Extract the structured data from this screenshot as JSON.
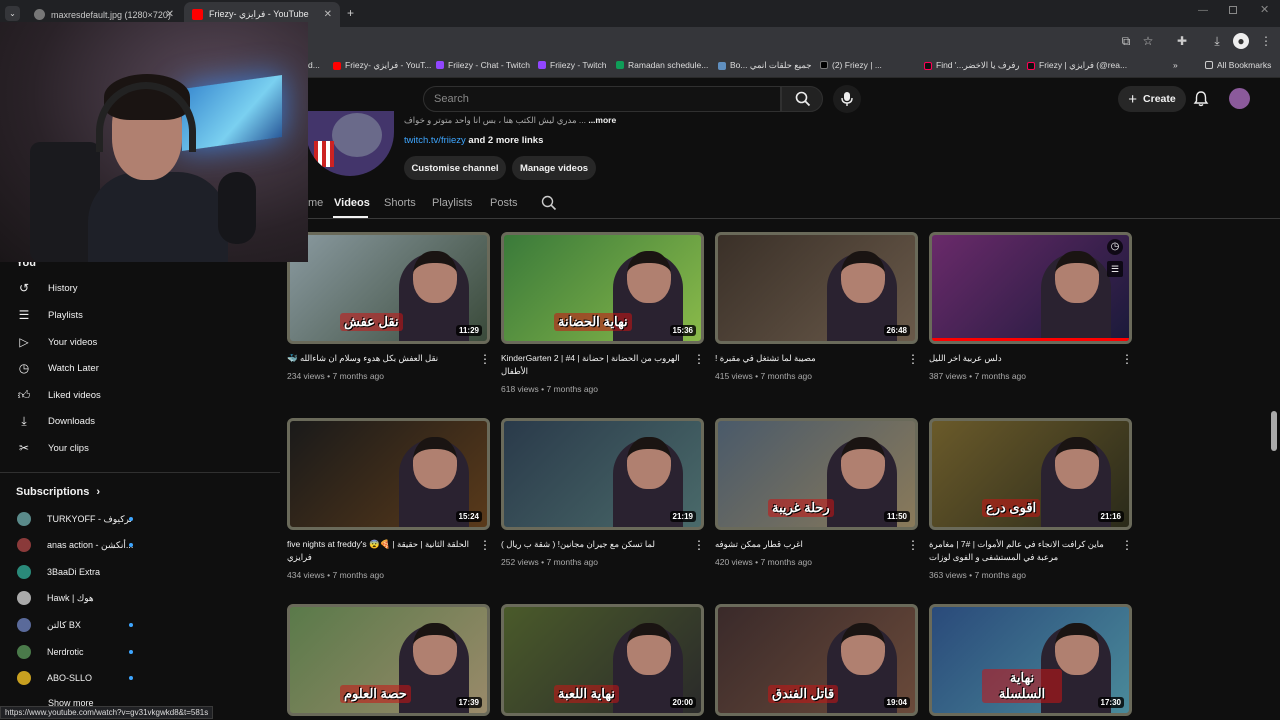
{
  "browser": {
    "tabs": [
      {
        "title": "maxresdefault.jpg (1280×720)",
        "active": false
      },
      {
        "title": "Friezy- فرايزي - YouTube",
        "active": true
      }
    ],
    "bookmarks": [
      "d...",
      "Friezy- فرايزي - YouT...",
      "Friiezy - Chat - Twitch",
      "Friiezy - Twitch",
      "Ramadan schedule...",
      "Bo... جميع حلقات انمي",
      "(2) Friezy | ...",
      "Find '...رفرف يا الاخضر",
      "Friezy | فرايزي (@rea...",
      "All Bookmarks"
    ],
    "status_url": "https://www.youtube.com/watch?v=gv31vkgwkd8&t=581s"
  },
  "header": {
    "search_placeholder": "Search",
    "create_label": "Create"
  },
  "channel": {
    "description": "...more",
    "link_text": "twitch.tv/friiezy",
    "more_links": "and 2 more links",
    "customise_label": "Customise channel",
    "manage_label": "Manage videos",
    "tabs": [
      "me",
      "Videos",
      "Shorts",
      "Playlists",
      "Posts"
    ]
  },
  "sidebar": {
    "you_label": "You",
    "items": [
      {
        "label": "History",
        "icon": "history-icon"
      },
      {
        "label": "Playlists",
        "icon": "playlists-icon"
      },
      {
        "label": "Your videos",
        "icon": "your-videos-icon"
      },
      {
        "label": "Watch Later",
        "icon": "watch-later-icon"
      },
      {
        "label": "Liked videos",
        "icon": "like-icon"
      },
      {
        "label": "Downloads",
        "icon": "download-icon"
      },
      {
        "label": "Your clips",
        "icon": "scissors-icon"
      }
    ],
    "subscriptions_title": "Subscriptions",
    "subscriptions": [
      {
        "name": "TURKYOFF - تركيوف",
        "color": "#5a8a8a"
      },
      {
        "name": "anas action - أنكشن...",
        "color": "#8a3a3a"
      },
      {
        "name": "3BaaDi Extra",
        "color": "#2a8a7a"
      },
      {
        "name": "Hawk | هوك",
        "color": "#aaaaaa"
      },
      {
        "name": "كالتن BX",
        "color": "#5a6a9a"
      },
      {
        "name": "Nerdrotic",
        "color": "#4a7a4a"
      },
      {
        "name": "ABO-SLLO",
        "color": "#c8a020"
      }
    ],
    "show_more": "Show more"
  },
  "videos": [
    {
      "title": "🐳 نقل العفش بكل هدوء وسلام ان شاءالله",
      "views": "234 views",
      "age": "7 months ago",
      "duration": "11:29",
      "colors": [
        "#8a9aa0",
        "#3a4a3a"
      ],
      "overlay_text": "نقل عفش"
    },
    {
      "title": "KinderGarten 2 | #4 | الهروب من الحضانة | حضانة الأطفال",
      "views": "618 views",
      "age": "7 months ago",
      "duration": "15:36",
      "colors": [
        "#3a7a3a",
        "#8aba4a"
      ],
      "overlay_text": "نهاية الحضانة"
    },
    {
      "title": "! مصيبة لما تشتغل في مقبرة",
      "views": "415 views",
      "age": "7 months ago",
      "duration": "26:48",
      "colors": [
        "#3a3028",
        "#6a5a4a"
      ],
      "overlay_text": ""
    },
    {
      "title": "دلس عربية اخر الليل",
      "views": "387 views",
      "age": "7 months ago",
      "duration": "",
      "colors": [
        "#6a2a6a",
        "#1a1a3a"
      ],
      "overlay_text": ""
    },
    {
      "title": "five nights at freddy's 😨🍕 | الحلقة الثانية | حقيقة فرايزي",
      "views": "434 views",
      "age": "7 months ago",
      "duration": "15:24",
      "colors": [
        "#1a1a1a",
        "#5a3a1a"
      ],
      "overlay_text": ""
    },
    {
      "title": "لما تسكن مع جيران مجانين! ( شقة ب ريال )",
      "views": "252 views",
      "age": "7 months ago",
      "duration": "21:19",
      "colors": [
        "#2a3a4a",
        "#4a6a6a"
      ],
      "overlay_text": ""
    },
    {
      "title": "اغرب قطار ممكن تشوفه",
      "views": "420 views",
      "age": "7 months ago",
      "duration": "11:50",
      "colors": [
        "#4a5a6a",
        "#8a7a5a"
      ],
      "overlay_text": "رحلة غريبة"
    },
    {
      "title": "ماين كرافت الانجاء في عالم الأموات | #7 | مغامرة مرعبة في المستشفى و الفوى لوزات",
      "views": "363 views",
      "age": "7 months ago",
      "duration": "21:16",
      "colors": [
        "#6a5a2a",
        "#2a2a1a"
      ],
      "overlay_text": "اقوى درع"
    },
    {
      "title": "",
      "views": "",
      "age": "",
      "duration": "17:39",
      "colors": [
        "#5a7a4a",
        "#9a8a6a"
      ],
      "overlay_text": "حصة العلوم"
    },
    {
      "title": "",
      "views": "",
      "age": "",
      "duration": "20:00",
      "colors": [
        "#4a5a2a",
        "#2a2a2a"
      ],
      "overlay_text": "نهاية اللعبة"
    },
    {
      "title": "",
      "views": "",
      "age": "",
      "duration": "19:04",
      "colors": [
        "#3a2a2a",
        "#6a4a3a"
      ],
      "overlay_text": "قاتل الفندق"
    },
    {
      "title": "",
      "views": "",
      "age": "",
      "duration": "17:30",
      "colors": [
        "#2a4a7a",
        "#4a8a9a"
      ],
      "overlay_text": "نهاية السلسلة"
    }
  ]
}
